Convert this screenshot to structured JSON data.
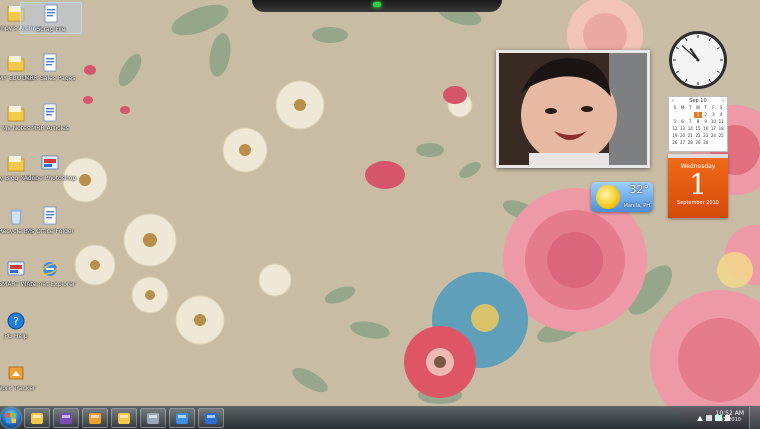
{
  "desktop": {
    "icons": [
      {
        "label": "Dumpy's Archive",
        "icon": "folder-icon"
      },
      {
        "label": "Scrap File",
        "icon": "document-icon"
      },
      {
        "label": "MY EBOOKS",
        "icon": "folder-icon"
      },
      {
        "label": "MRR Sales Pages",
        "icon": "document-icon"
      },
      {
        "label": "My Notes",
        "icon": "folder-icon"
      },
      {
        "label": "MRR Articles",
        "icon": "document-icon"
      },
      {
        "label": "My Blog Notes",
        "icon": "folder-icon"
      },
      {
        "label": "Adobe Photoshop",
        "icon": "app-icon"
      },
      {
        "label": "Recycle Bin",
        "icon": "recycle-bin-icon"
      },
      {
        "label": "Ms Office Folder",
        "icon": "document-icon"
      },
      {
        "label": "SMART WAY",
        "icon": "app-icon"
      },
      {
        "label": "Internet Explorer",
        "icon": "internet-explorer-icon"
      },
      {
        "label": "PC Help",
        "icon": "help-icon"
      },
      {
        "label": "Work Tracker",
        "icon": "shortcut-icon"
      }
    ]
  },
  "gadgets": {
    "weather": {
      "temperature": "32°",
      "location": "Manila, PH"
    },
    "calendar": {
      "month_label": "Sep 10",
      "day_headers": [
        "S",
        "M",
        "T",
        "W",
        "T",
        "F",
        "S"
      ],
      "days": [
        "",
        "",
        "",
        "1",
        "2",
        "3",
        "4",
        "5",
        "6",
        "7",
        "8",
        "9",
        "10",
        "11",
        "12",
        "13",
        "14",
        "15",
        "16",
        "17",
        "18",
        "19",
        "20",
        "21",
        "22",
        "23",
        "24",
        "25",
        "26",
        "27",
        "28",
        "29",
        "30",
        "",
        ""
      ],
      "today": "1",
      "weekday": "Wednesday",
      "day_number": "1",
      "month_year": "September 2010"
    },
    "clock": {
      "hours": 10,
      "minutes": 52
    }
  },
  "taskbar": {
    "time": "10:52 AM",
    "date": "9/1/2010",
    "pinned": [
      "windows-explorer-icon",
      "messenger-icon",
      "photo-icon",
      "folder-icon",
      "settings-icon",
      "internet-explorer-icon",
      "window-icon"
    ]
  }
}
